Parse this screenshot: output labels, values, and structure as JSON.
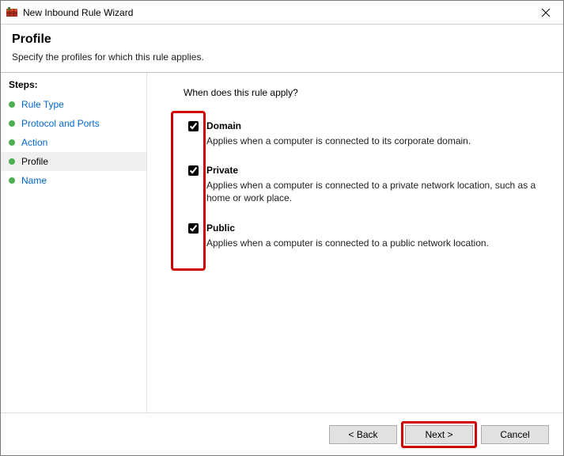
{
  "window": {
    "title": "New Inbound Rule Wizard"
  },
  "header": {
    "heading": "Profile",
    "subtext": "Specify the profiles for which this rule applies."
  },
  "sidebar": {
    "heading": "Steps:",
    "items": [
      {
        "label": "Rule Type",
        "state": "done"
      },
      {
        "label": "Protocol and Ports",
        "state": "done"
      },
      {
        "label": "Action",
        "state": "done"
      },
      {
        "label": "Profile",
        "state": "current"
      },
      {
        "label": "Name",
        "state": "pending"
      }
    ]
  },
  "main": {
    "question": "When does this rule apply?",
    "options": [
      {
        "key": "domain",
        "checked": true,
        "label": "Domain",
        "desc": "Applies when a computer is connected to its corporate domain."
      },
      {
        "key": "private",
        "checked": true,
        "label": "Private",
        "desc": "Applies when a computer is connected to a private network location, such as a home or work place."
      },
      {
        "key": "public",
        "checked": true,
        "label": "Public",
        "desc": "Applies when a computer is connected to a public network location."
      }
    ]
  },
  "footer": {
    "back": "< Back",
    "next": "Next >",
    "cancel": "Cancel"
  },
  "highlights": {
    "checkboxes_box": true,
    "next_button": true
  }
}
